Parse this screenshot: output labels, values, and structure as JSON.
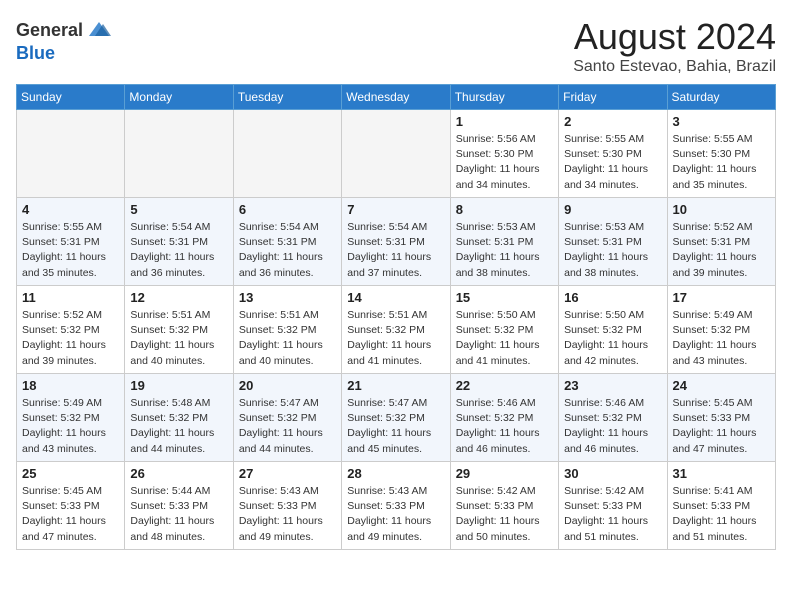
{
  "header": {
    "logo_general": "General",
    "logo_blue": "Blue",
    "title": "August 2024",
    "subtitle": "Santo Estevao, Bahia, Brazil"
  },
  "weekdays": [
    "Sunday",
    "Monday",
    "Tuesday",
    "Wednesday",
    "Thursday",
    "Friday",
    "Saturday"
  ],
  "weeks": [
    [
      {
        "day": "",
        "detail": ""
      },
      {
        "day": "",
        "detail": ""
      },
      {
        "day": "",
        "detail": ""
      },
      {
        "day": "",
        "detail": ""
      },
      {
        "day": "1",
        "detail": "Sunrise: 5:56 AM\nSunset: 5:30 PM\nDaylight: 11 hours\nand 34 minutes."
      },
      {
        "day": "2",
        "detail": "Sunrise: 5:55 AM\nSunset: 5:30 PM\nDaylight: 11 hours\nand 34 minutes."
      },
      {
        "day": "3",
        "detail": "Sunrise: 5:55 AM\nSunset: 5:30 PM\nDaylight: 11 hours\nand 35 minutes."
      }
    ],
    [
      {
        "day": "4",
        "detail": "Sunrise: 5:55 AM\nSunset: 5:31 PM\nDaylight: 11 hours\nand 35 minutes."
      },
      {
        "day": "5",
        "detail": "Sunrise: 5:54 AM\nSunset: 5:31 PM\nDaylight: 11 hours\nand 36 minutes."
      },
      {
        "day": "6",
        "detail": "Sunrise: 5:54 AM\nSunset: 5:31 PM\nDaylight: 11 hours\nand 36 minutes."
      },
      {
        "day": "7",
        "detail": "Sunrise: 5:54 AM\nSunset: 5:31 PM\nDaylight: 11 hours\nand 37 minutes."
      },
      {
        "day": "8",
        "detail": "Sunrise: 5:53 AM\nSunset: 5:31 PM\nDaylight: 11 hours\nand 38 minutes."
      },
      {
        "day": "9",
        "detail": "Sunrise: 5:53 AM\nSunset: 5:31 PM\nDaylight: 11 hours\nand 38 minutes."
      },
      {
        "day": "10",
        "detail": "Sunrise: 5:52 AM\nSunset: 5:31 PM\nDaylight: 11 hours\nand 39 minutes."
      }
    ],
    [
      {
        "day": "11",
        "detail": "Sunrise: 5:52 AM\nSunset: 5:32 PM\nDaylight: 11 hours\nand 39 minutes."
      },
      {
        "day": "12",
        "detail": "Sunrise: 5:51 AM\nSunset: 5:32 PM\nDaylight: 11 hours\nand 40 minutes."
      },
      {
        "day": "13",
        "detail": "Sunrise: 5:51 AM\nSunset: 5:32 PM\nDaylight: 11 hours\nand 40 minutes."
      },
      {
        "day": "14",
        "detail": "Sunrise: 5:51 AM\nSunset: 5:32 PM\nDaylight: 11 hours\nand 41 minutes."
      },
      {
        "day": "15",
        "detail": "Sunrise: 5:50 AM\nSunset: 5:32 PM\nDaylight: 11 hours\nand 41 minutes."
      },
      {
        "day": "16",
        "detail": "Sunrise: 5:50 AM\nSunset: 5:32 PM\nDaylight: 11 hours\nand 42 minutes."
      },
      {
        "day": "17",
        "detail": "Sunrise: 5:49 AM\nSunset: 5:32 PM\nDaylight: 11 hours\nand 43 minutes."
      }
    ],
    [
      {
        "day": "18",
        "detail": "Sunrise: 5:49 AM\nSunset: 5:32 PM\nDaylight: 11 hours\nand 43 minutes."
      },
      {
        "day": "19",
        "detail": "Sunrise: 5:48 AM\nSunset: 5:32 PM\nDaylight: 11 hours\nand 44 minutes."
      },
      {
        "day": "20",
        "detail": "Sunrise: 5:47 AM\nSunset: 5:32 PM\nDaylight: 11 hours\nand 44 minutes."
      },
      {
        "day": "21",
        "detail": "Sunrise: 5:47 AM\nSunset: 5:32 PM\nDaylight: 11 hours\nand 45 minutes."
      },
      {
        "day": "22",
        "detail": "Sunrise: 5:46 AM\nSunset: 5:32 PM\nDaylight: 11 hours\nand 46 minutes."
      },
      {
        "day": "23",
        "detail": "Sunrise: 5:46 AM\nSunset: 5:32 PM\nDaylight: 11 hours\nand 46 minutes."
      },
      {
        "day": "24",
        "detail": "Sunrise: 5:45 AM\nSunset: 5:33 PM\nDaylight: 11 hours\nand 47 minutes."
      }
    ],
    [
      {
        "day": "25",
        "detail": "Sunrise: 5:45 AM\nSunset: 5:33 PM\nDaylight: 11 hours\nand 47 minutes."
      },
      {
        "day": "26",
        "detail": "Sunrise: 5:44 AM\nSunset: 5:33 PM\nDaylight: 11 hours\nand 48 minutes."
      },
      {
        "day": "27",
        "detail": "Sunrise: 5:43 AM\nSunset: 5:33 PM\nDaylight: 11 hours\nand 49 minutes."
      },
      {
        "day": "28",
        "detail": "Sunrise: 5:43 AM\nSunset: 5:33 PM\nDaylight: 11 hours\nand 49 minutes."
      },
      {
        "day": "29",
        "detail": "Sunrise: 5:42 AM\nSunset: 5:33 PM\nDaylight: 11 hours\nand 50 minutes."
      },
      {
        "day": "30",
        "detail": "Sunrise: 5:42 AM\nSunset: 5:33 PM\nDaylight: 11 hours\nand 51 minutes."
      },
      {
        "day": "31",
        "detail": "Sunrise: 5:41 AM\nSunset: 5:33 PM\nDaylight: 11 hours\nand 51 minutes."
      }
    ]
  ]
}
